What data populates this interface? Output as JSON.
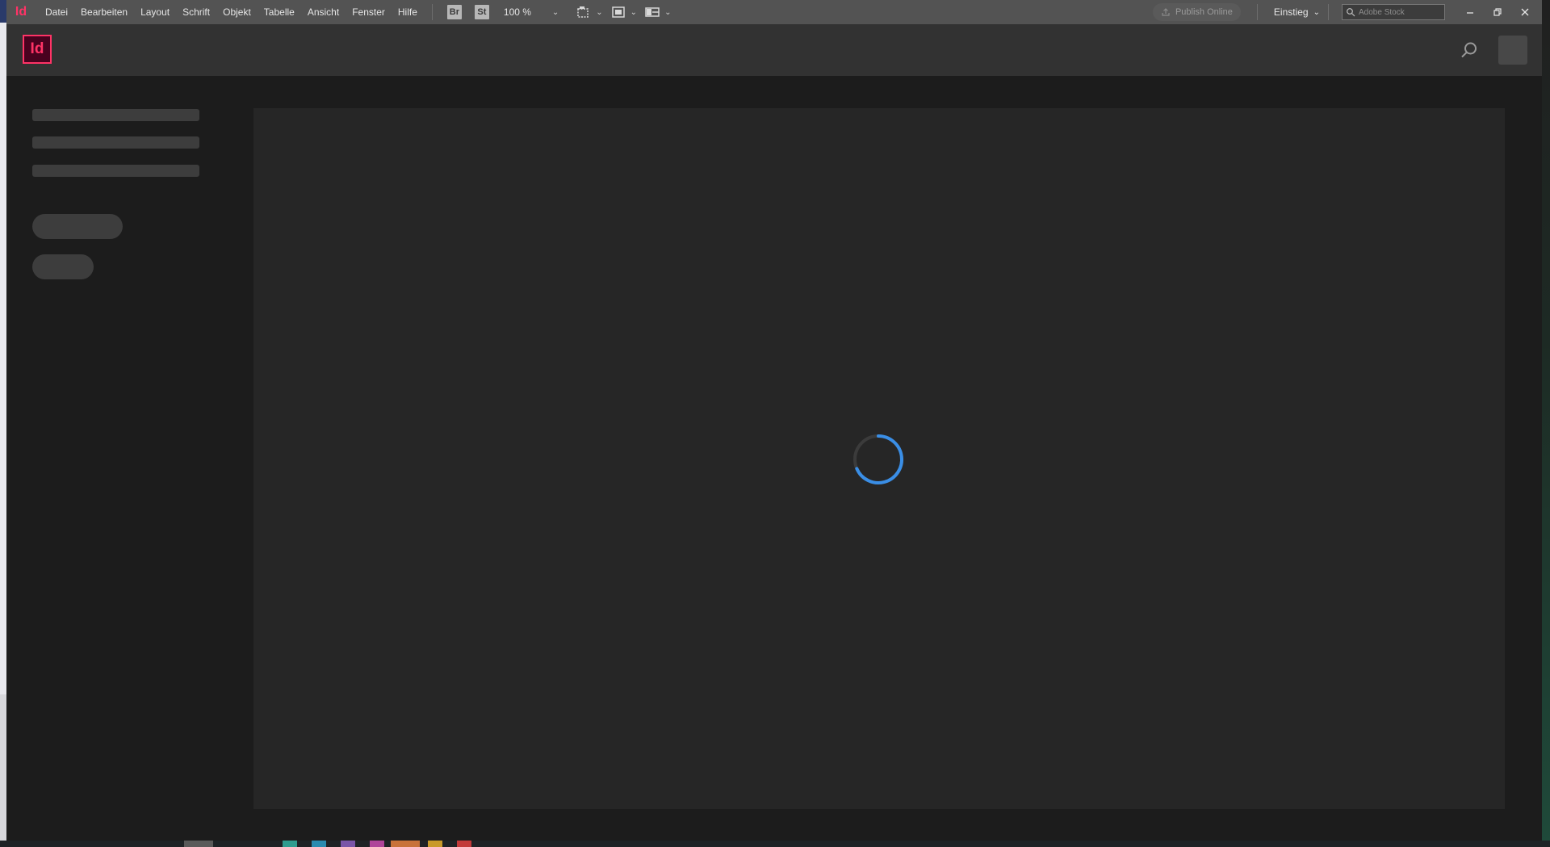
{
  "app": {
    "short_logo": "Id",
    "home_logo": "Id",
    "accent": "#ff3366"
  },
  "menu": {
    "items": [
      "Datei",
      "Bearbeiten",
      "Layout",
      "Schrift",
      "Objekt",
      "Tabelle",
      "Ansicht",
      "Fenster",
      "Hilfe"
    ],
    "bridge_label": "Br",
    "stock_label": "St",
    "zoom": "100 %",
    "publish_online": "Publish Online",
    "workspace": "Einstieg",
    "stock_search_placeholder": "Adobe Stock"
  },
  "home": {
    "loading": true,
    "spinner_color": "#3a8ee6"
  }
}
